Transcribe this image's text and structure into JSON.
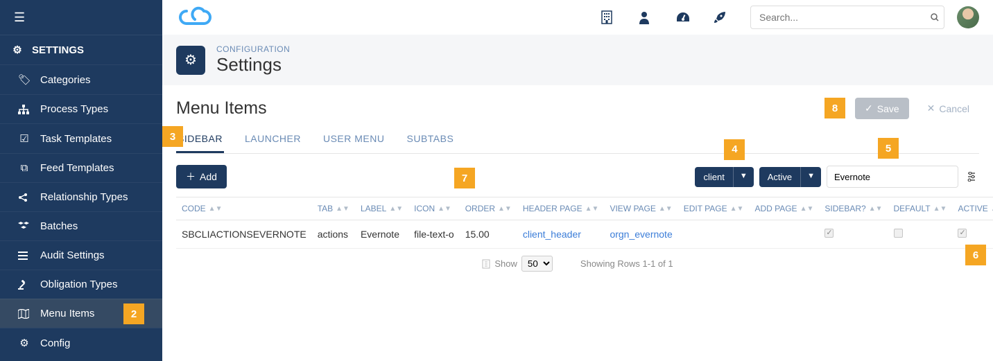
{
  "sidebar": {
    "header_label": "SETTINGS",
    "items": [
      {
        "label": "Categories"
      },
      {
        "label": "Process Types"
      },
      {
        "label": "Task Templates"
      },
      {
        "label": "Feed Templates"
      },
      {
        "label": "Relationship Types"
      },
      {
        "label": "Batches"
      },
      {
        "label": "Audit Settings"
      },
      {
        "label": "Obligation Types"
      },
      {
        "label": "Menu Items"
      },
      {
        "label": "Config"
      }
    ]
  },
  "topbar": {
    "search_placeholder": "Search..."
  },
  "page": {
    "crumb": "CONFIGURATION",
    "title": "Settings",
    "section_title": "Menu Items",
    "save_label": "Save",
    "cancel_label": "Cancel"
  },
  "tabs": [
    "SIDEBAR",
    "LAUNCHER",
    "USER MENU",
    "SUBTABS"
  ],
  "toolbar": {
    "add_label": "Add",
    "filter1": "client",
    "filter2": "Active",
    "filter_text": "Evernote"
  },
  "columns": [
    "CODE",
    "TAB",
    "LABEL",
    "ICON",
    "ORDER",
    "HEADER PAGE",
    "VIEW PAGE",
    "EDIT PAGE",
    "ADD PAGE",
    "SIDEBAR?",
    "DEFAULT",
    "ACTIVE"
  ],
  "rows": [
    {
      "code": "SBCLIACTIONSEVERNOTE",
      "tab": "actions",
      "label": "Evernote",
      "icon": "file-text-o",
      "order": "15.00",
      "header_page": "client_header",
      "view_page": "orgn_evernote",
      "edit_page": "",
      "add_page": "",
      "sidebar": true,
      "default": false,
      "active": true
    }
  ],
  "footer": {
    "show_label": "Show",
    "page_size": "50",
    "rows_text": "Showing Rows 1-1 of 1"
  },
  "annotations": {
    "a2": "2",
    "a3": "3",
    "a4": "4",
    "a5": "5",
    "a6": "6",
    "a7": "7",
    "a8": "8"
  }
}
